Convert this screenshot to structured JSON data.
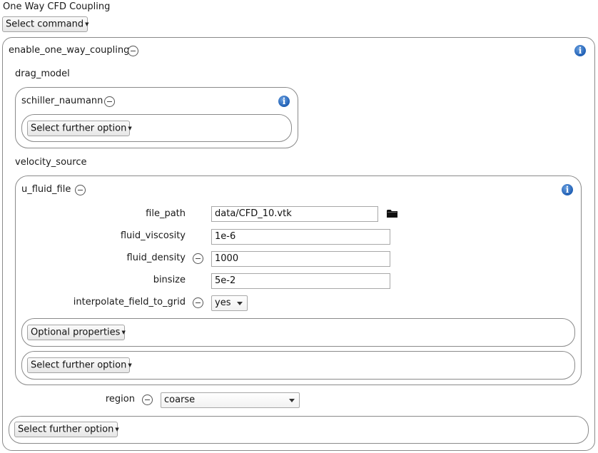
{
  "title": "One Way CFD Coupling",
  "select_command": "Select command",
  "coupling": {
    "label": "enable_one_way_coupling",
    "drag_model_label": "drag_model",
    "drag": {
      "label": "schiller_naumann",
      "further": "Select further option"
    },
    "velocity_source_label": "velocity_source",
    "u_fluid": {
      "label": "u_fluid_file",
      "fields": {
        "file_path": {
          "label": "file_path",
          "value": "data/CFD_10.vtk"
        },
        "fluid_viscosity": {
          "label": "fluid_viscosity",
          "value": "1e-6"
        },
        "fluid_density": {
          "label": "fluid_density",
          "value": "1000"
        },
        "binsize": {
          "label": "binsize",
          "value": "5e-2"
        },
        "interpolate": {
          "label": "interpolate_field_to_grid",
          "value": "yes"
        }
      },
      "optional": "Optional properties",
      "further": "Select further option"
    },
    "region": {
      "label": "region",
      "value": "coarse"
    },
    "further": "Select further option"
  },
  "icons": {
    "info": "info-icon",
    "remove": "minus-circle-icon",
    "folder": "folder-icon"
  },
  "colors": {
    "info_blue": "#1f5fb4",
    "border": "#8a8a8a"
  }
}
